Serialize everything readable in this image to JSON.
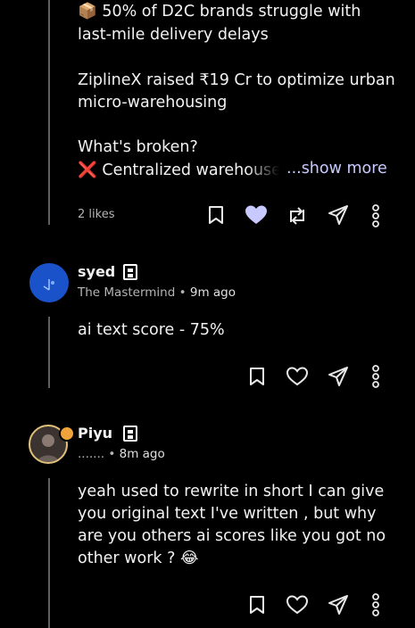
{
  "post": {
    "line1": "📦 50% of D2C brands struggle with",
    "line2": "last-mile delivery delays",
    "line3": "ZiplineX raised ₹19 Cr to optimize urban",
    "line4": "micro-warehousing",
    "line5": "What's broken?",
    "line6": "❌ Centralized warehouse",
    "show_more": "...show more",
    "likes": "2 likes"
  },
  "comments": [
    {
      "name": "syed",
      "title": "The Mastermind",
      "time": "9m ago",
      "text": "ai text score - 75%"
    },
    {
      "name": "Piyu",
      "title": ".......",
      "time": "8m ago",
      "text_lines": [
        "yeah used to rewrite in short I can give",
        "you original text I've written , but why",
        "are you others ai scores like you got no",
        "other work ? 😂"
      ]
    }
  ],
  "separator": "•",
  "colors": {
    "liked_heart": "#c7c9ff",
    "show_more": "#c7c9ff",
    "avatar_blue": "#1a52c9"
  }
}
